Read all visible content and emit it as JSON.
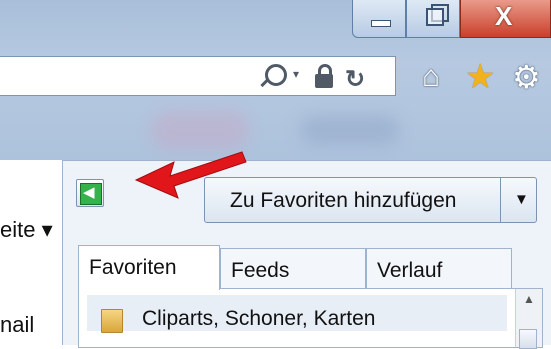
{
  "window": {
    "controls": {
      "minimize_icon": "minimize-icon",
      "maximize_icon": "restore-icon",
      "close_label": "X"
    }
  },
  "addressbar": {
    "icons": [
      "search-icon",
      "chevron-down-icon",
      "lock-icon",
      "refresh-icon"
    ],
    "dropdown_glyph": "▾",
    "refresh_glyph": "↻"
  },
  "toolbar": {
    "home_glyph": "⌂",
    "favorites_glyph": "★",
    "tools_glyph": "⚙"
  },
  "page": {
    "left_text_1": "eite ▾",
    "left_text_2": "nail"
  },
  "favorites_panel": {
    "pin_button_icon": "pin-to-left-icon",
    "add_button_label": "Zu Favoriten hinzufügen",
    "add_button_arrow": "▼",
    "tabs": [
      {
        "label": "Favoriten",
        "active": true
      },
      {
        "label": "Feeds",
        "active": false
      },
      {
        "label": "Verlauf",
        "active": false
      }
    ],
    "items": [
      {
        "label": "Cliparts, Schoner, Karten",
        "icon": "folder-icon"
      }
    ],
    "scroll_up_glyph": "▲"
  },
  "colors": {
    "frame": "#b6c9e1",
    "close_button": "#c9402b",
    "star": "#f2b21a",
    "annotation_arrow": "#e0161a",
    "pin_green": "#36b24b"
  }
}
